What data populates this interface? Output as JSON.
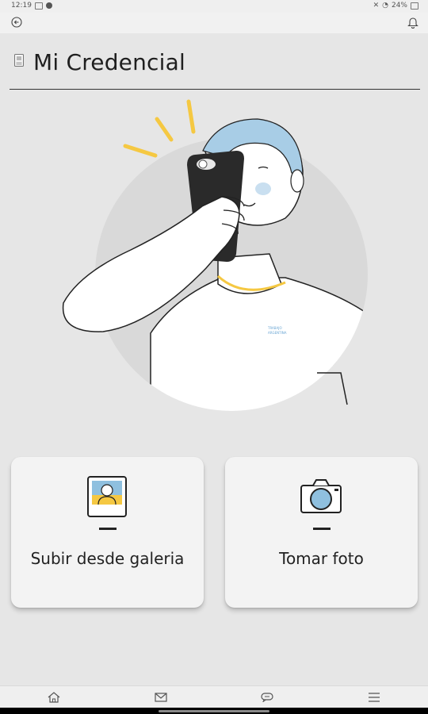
{
  "status_bar": {
    "time": "12:19",
    "battery": "24%"
  },
  "header": {
    "title": "Mi Credencial"
  },
  "illustration": {
    "shirt_text_line1": "TRABAJO",
    "shirt_text_line2": "ARGENTINA"
  },
  "actions": [
    {
      "label": "Subir desde galeria",
      "icon": "gallery-photo-icon"
    },
    {
      "label": "Tomar foto",
      "icon": "camera-icon"
    }
  ],
  "bottom_nav": [
    {
      "icon": "home-icon"
    },
    {
      "icon": "mail-icon"
    },
    {
      "icon": "chat-icon"
    },
    {
      "icon": "menu-icon"
    }
  ],
  "colors": {
    "accent_yellow": "#f5c842",
    "hair_blue": "#a8cde6",
    "photo_blue": "#8fc0df"
  }
}
